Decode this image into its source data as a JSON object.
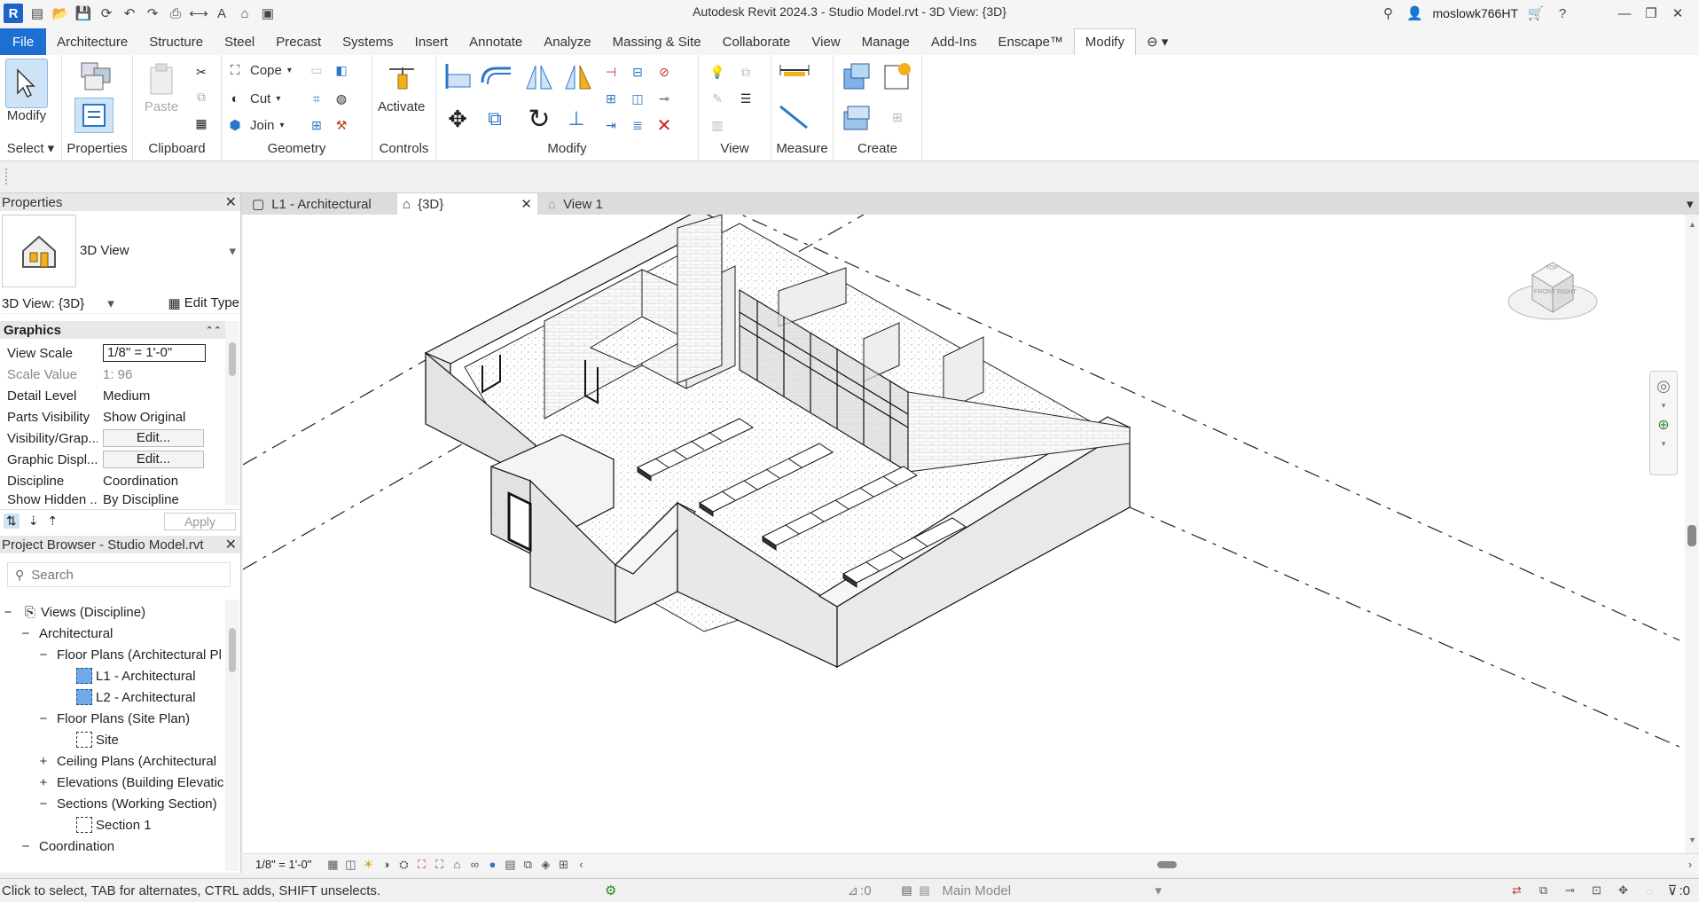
{
  "window": {
    "title": "Autodesk Revit 2024.3 - Studio Model.rvt - 3D View: {3D}",
    "username": "moslowk766HT"
  },
  "ribbon_tabs": [
    "File",
    "Architecture",
    "Structure",
    "Steel",
    "Precast",
    "Systems",
    "Insert",
    "Annotate",
    "Analyze",
    "Massing & Site",
    "Collaborate",
    "View",
    "Manage",
    "Add-Ins",
    "Enscape™",
    "Modify"
  ],
  "ribbon": {
    "select": {
      "modify_label": "Modify",
      "panel_title": "Select"
    },
    "properties": {
      "panel_title": "Properties"
    },
    "clipboard": {
      "paste_label": "Paste",
      "panel_title": "Clipboard"
    },
    "geometry": {
      "cope": "Cope",
      "cut": "Cut",
      "join": "Join",
      "panel_title": "Geometry"
    },
    "controls": {
      "activate": "Activate",
      "panel_title": "Controls"
    },
    "modify": {
      "panel_title": "Modify"
    },
    "view": {
      "panel_title": "View"
    },
    "measure": {
      "panel_title": "Measure"
    },
    "create": {
      "panel_title": "Create"
    }
  },
  "properties_palette": {
    "title": "Properties",
    "type_name": "3D View",
    "instance_selector": "3D View: {3D}",
    "edit_type": "Edit Type",
    "group": "Graphics",
    "rows": [
      {
        "key": "View Scale",
        "value": "1/8\" = 1'-0\""
      },
      {
        "key": "Scale Value",
        "value": "1:  96"
      },
      {
        "key": "Detail Level",
        "value": "Medium"
      },
      {
        "key": "Parts Visibility",
        "value": "Show Original"
      },
      {
        "key": "Visibility/Grap...",
        "value": "Edit..."
      },
      {
        "key": "Graphic Displ...",
        "value": "Edit..."
      },
      {
        "key": "Discipline",
        "value": "Coordination"
      },
      {
        "key": "Show Hidden ...",
        "value": "By Discipline"
      }
    ],
    "apply": "Apply"
  },
  "project_browser": {
    "title": "Project Browser - Studio Model.rvt",
    "search_placeholder": "Search",
    "items": [
      {
        "label": "Views (Discipline)",
        "toggle": "−"
      },
      {
        "label": "Architectural",
        "toggle": "−"
      },
      {
        "label": "Floor Plans (Architectural Pl",
        "toggle": "−"
      },
      {
        "label": "L1 - Architectural",
        "toggle": ""
      },
      {
        "label": "L2 - Architectural",
        "toggle": ""
      },
      {
        "label": "Floor Plans (Site Plan)",
        "toggle": "−"
      },
      {
        "label": "Site",
        "toggle": ""
      },
      {
        "label": "Ceiling Plans (Architectural",
        "toggle": "+"
      },
      {
        "label": "Elevations (Building Elevatic",
        "toggle": "+"
      },
      {
        "label": "Sections (Working Section)",
        "toggle": "−"
      },
      {
        "label": "Section 1",
        "toggle": ""
      },
      {
        "label": "Coordination",
        "toggle": "−"
      }
    ]
  },
  "view_tabs": [
    {
      "label": "L1 - Architectural"
    },
    {
      "label": "{3D}"
    },
    {
      "label": "View 1"
    }
  ],
  "view_control_bar": {
    "scale": "1/8\" = 1'-0\""
  },
  "viewcube": {
    "top": "TOP",
    "front": "FRONT",
    "right": "RIGHT"
  },
  "status_bar": {
    "hint": "Click to select, TAB for alternates, CTRL adds, SHIFT unselects.",
    "worksharing_count": ":0",
    "model": "Main Model",
    "filter_count": ":0"
  }
}
